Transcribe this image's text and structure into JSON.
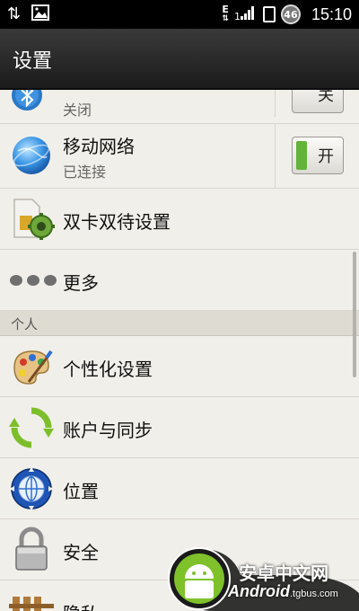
{
  "statusbar": {
    "network_type": "E",
    "battery_level": "46",
    "time": "15:10"
  },
  "header": {
    "title": "设置"
  },
  "rows": [
    {
      "id": "bluetooth",
      "subtitle": "关闭",
      "toggle_label": "关"
    },
    {
      "id": "mobile-network",
      "title": "移动网络",
      "subtitle": "已连接",
      "toggle_label": "开"
    },
    {
      "id": "dual-sim",
      "title": "双卡双待设置"
    },
    {
      "id": "more",
      "title": "更多"
    }
  ],
  "section": {
    "label": "个人"
  },
  "personal_rows": [
    {
      "id": "personalize",
      "title": "个性化设置"
    },
    {
      "id": "accounts",
      "title": "账户与同步"
    },
    {
      "id": "location",
      "title": "位置"
    },
    {
      "id": "security",
      "title": "安全"
    },
    {
      "id": "privacy",
      "title": "隐私"
    }
  ],
  "watermark": {
    "cn": "安卓中文网",
    "en": "Android",
    "url": ".tgbus.com"
  },
  "colors": {
    "accent_green": "#62b33a",
    "header_bg": "#1b1b1b"
  }
}
